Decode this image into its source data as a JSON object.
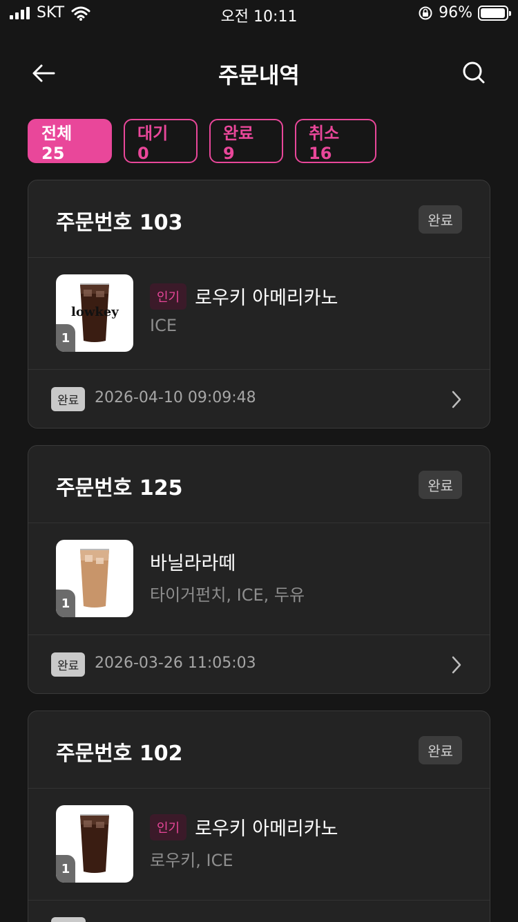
{
  "status_bar": {
    "carrier": "SKT",
    "time": "오전 10:11",
    "battery": "96%",
    "battery_level": 0.96
  },
  "header": {
    "title": "주문내역",
    "back_icon": "back-arrow-icon",
    "search_icon": "search-icon"
  },
  "filters": [
    {
      "label": "전체 25",
      "active": true
    },
    {
      "label": "대기 0",
      "active": false
    },
    {
      "label": "완료 9",
      "active": false
    },
    {
      "label": "취소 16",
      "active": false
    }
  ],
  "orders": [
    {
      "order_no": "주문번호 103",
      "status": "완료",
      "qty": "1",
      "tag": "인기",
      "item_name": "로우키 아메리카노",
      "options": "ICE",
      "thumb_text": "lowkey",
      "footer_status": "완료",
      "datetime": "2026-04-10 09:09:48"
    },
    {
      "order_no": "주문번호 125",
      "status": "완료",
      "qty": "1",
      "tag": "",
      "item_name": "바닐라라떼",
      "options": "타이거펀치, ICE, 두유",
      "footer_status": "완료",
      "datetime": "2026-03-26 11:05:03"
    },
    {
      "order_no": "주문번호 102",
      "status": "완료",
      "qty": "1",
      "tag": "인기",
      "item_name": "로우키 아메리카노",
      "options": "로우키, ICE"
    }
  ],
  "colors": {
    "accent": "#e9479a",
    "background": "#161616",
    "card": "#232323"
  }
}
